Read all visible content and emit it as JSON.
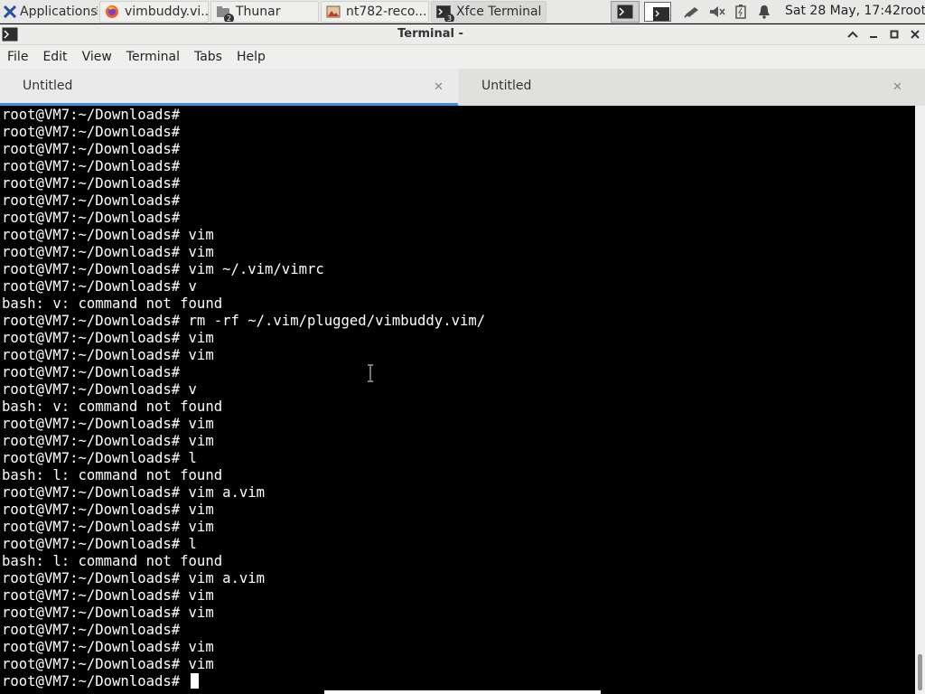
{
  "panel": {
    "applications_label": "Applications",
    "tasks": [
      {
        "label": "vimbuddy.vi...",
        "icon": "firefox-icon"
      },
      {
        "label": "Thunar",
        "icon": "folder-icon",
        "badge": "2"
      },
      {
        "label": "nt782-reco...",
        "icon": "image-viewer-icon"
      },
      {
        "label": "Xfce Terminal",
        "icon": "terminal-icon",
        "badge": "3"
      }
    ],
    "clock": "Sat 28 May, 17:42",
    "user": "root"
  },
  "window": {
    "title": "Terminal -"
  },
  "menubar": [
    "File",
    "Edit",
    "View",
    "Terminal",
    "Tabs",
    "Help"
  ],
  "tabs": [
    {
      "label": "Untitled",
      "active": true
    },
    {
      "label": "Untitled",
      "active": false
    }
  ],
  "terminal": {
    "lines": [
      "root@VM7:~/Downloads#",
      "root@VM7:~/Downloads#",
      "root@VM7:~/Downloads#",
      "root@VM7:~/Downloads#",
      "root@VM7:~/Downloads#",
      "root@VM7:~/Downloads#",
      "root@VM7:~/Downloads#",
      "root@VM7:~/Downloads# vim",
      "root@VM7:~/Downloads# vim",
      "root@VM7:~/Downloads# vim ~/.vim/vimrc",
      "root@VM7:~/Downloads# v",
      "bash: v: command not found",
      "root@VM7:~/Downloads# rm -rf ~/.vim/plugged/vimbuddy.vim/",
      "root@VM7:~/Downloads# vim",
      "root@VM7:~/Downloads# vim",
      "root@VM7:~/Downloads#",
      "root@VM7:~/Downloads# v",
      "bash: v: command not found",
      "root@VM7:~/Downloads# vim",
      "root@VM7:~/Downloads# vim",
      "root@VM7:~/Downloads# l",
      "bash: l: command not found",
      "root@VM7:~/Downloads# vim a.vim",
      "root@VM7:~/Downloads# vim",
      "root@VM7:~/Downloads# vim",
      "root@VM7:~/Downloads# l",
      "bash: l: command not found",
      "root@VM7:~/Downloads# vim a.vim",
      "root@VM7:~/Downloads# vim",
      "root@VM7:~/Downloads# vim",
      "root@VM7:~/Downloads#",
      "root@VM7:~/Downloads# vim",
      "root@VM7:~/Downloads# vim"
    ],
    "prompt": "root@VM7:~/Downloads# "
  },
  "colors": {
    "accent": "#3d8ee7",
    "terminal_bg": "#000000",
    "terminal_fg": "#ffffff"
  }
}
